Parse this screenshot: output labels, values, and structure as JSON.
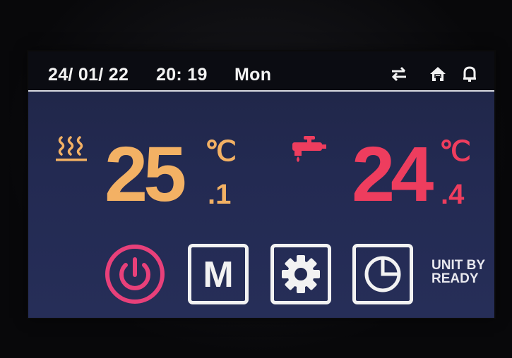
{
  "status_bar": {
    "date": "24/ 01/ 22",
    "time": "20: 19",
    "day": "Mon",
    "icons": [
      "transfer-icon",
      "home-icon",
      "bell-icon"
    ]
  },
  "heating": {
    "icon": "heating-icon",
    "value": "25",
    "decimal": ".1",
    "unit": "℃",
    "color": "#f3b164"
  },
  "hot_water": {
    "icon": "tap-icon",
    "value": "24",
    "decimal": ".4",
    "unit": "℃",
    "color": "#ee3d5e"
  },
  "controls": {
    "power_icon": "power-icon",
    "mode_label": "M",
    "settings_icon": "gear-icon",
    "timer_icon": "clock-icon"
  },
  "unit_status": {
    "line1": "UNIT BY",
    "line2": "READY"
  },
  "colors": {
    "screen_bg": "#232a52",
    "power": "#e8407a",
    "white": "#f2f2f2"
  }
}
